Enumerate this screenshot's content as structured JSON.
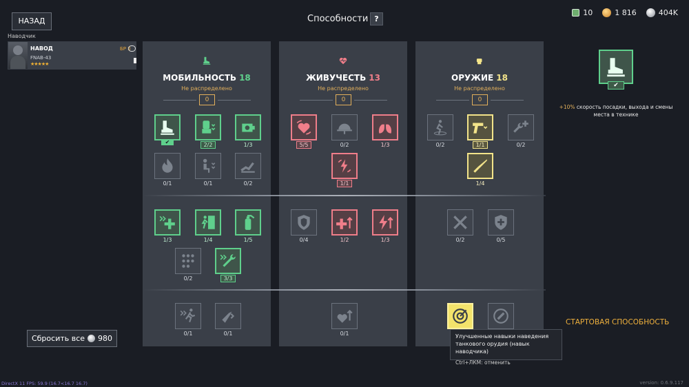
{
  "header": {
    "title": "Способности",
    "help_label": "?",
    "back_label": "НАЗАД"
  },
  "currencies": {
    "premium": "10",
    "gold": "1 816",
    "silver": "404K"
  },
  "crew": {
    "section_label": "Наводчик",
    "name": "НАВОД",
    "vehicle": "FNAB-43",
    "stars": "★★★★★",
    "br": "БР II"
  },
  "columns": [
    {
      "title": "МОБИЛЬНОСТЬ",
      "points": "18",
      "unallocated": "Не распределено",
      "counter": "0",
      "color": "#5fd08c",
      "skills": [
        "",
        "2/2",
        "1/3",
        "0/1",
        "0/1",
        "0/2",
        "1/3",
        "1/4",
        "1/5",
        "0/2",
        "3/3",
        "0/1",
        "0/1"
      ]
    },
    {
      "title": "ЖИВУЧЕСТЬ",
      "points": "13",
      "unallocated": "Не распределено",
      "counter": "0",
      "color": "#f07e8a",
      "skills": [
        "5/5",
        "0/2",
        "1/3",
        "1/1",
        "0/4",
        "1/2",
        "1/3",
        "0/1"
      ]
    },
    {
      "title": "ОРУЖИЕ",
      "points": "18",
      "unallocated": "Не распределено",
      "counter": "0",
      "color": "#f3e48a",
      "skills": [
        "0/2",
        "1/1",
        "0/2",
        "1/4",
        "0/2",
        "0/5"
      ]
    }
  ],
  "preview": {
    "tick": "✔",
    "desc_highlight": "+10%",
    "desc_text": " скорость посадки, выхода и смены места в технике"
  },
  "start_ability": "СТАРТОВАЯ СПОСОБНОСТЬ",
  "reset": {
    "label": "Сбросить все",
    "cost": "980"
  },
  "tooltip": {
    "title": "Улучшенные навыки наведения танкового орудия (навык наводчика)",
    "hint": "Ctrl+ЛКМ: отменить"
  },
  "footer": {
    "fps": "DirectX 11 FPS: 59.9 (16.7<16.7 16.7)",
    "version": "version: 0.6.9.117"
  }
}
